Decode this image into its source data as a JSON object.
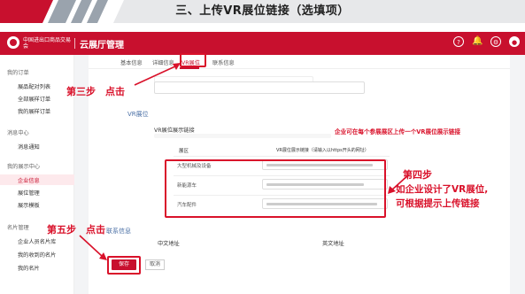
{
  "banner": {
    "title": "三、上传VR展位链接（选填项）"
  },
  "topnav": {
    "org_name": "中国进出口商品交易会",
    "app_title": "云展厅管理",
    "icons": [
      "help-icon",
      "bell-icon",
      "settings-icon",
      "user-icon"
    ]
  },
  "sidebar": {
    "groups": [
      {
        "label": "我的订单",
        "items": [
          "展品配对列表",
          "全部展样订单",
          "我的展样订单"
        ]
      },
      {
        "label": "消息中心",
        "items": [
          "消息通知"
        ]
      },
      {
        "label": "我的展示中心",
        "items": [
          "企业信息",
          "展位管理",
          "展示模板"
        ]
      },
      {
        "label": "名片管理",
        "items": [
          "企业人员名片库",
          "我的收到的名片",
          "我的名片"
        ]
      }
    ],
    "active_item": "企业信息"
  },
  "tabs": [
    "基本信息",
    "详细信息",
    "VR展位",
    "联系信息"
  ],
  "active_tab": "VR展位",
  "section_vr": "VR展位",
  "vr_label": "VR展位展示链接",
  "table": {
    "col1": "展区",
    "col2": "VR展位展示链接（请输入以https开头的网址）",
    "rows": [
      "大型机械及设备",
      "新能源车",
      "汽车配件"
    ]
  },
  "section_contact": "联系信息",
  "contact_labels": [
    "中文地址",
    "英文地址"
  ],
  "buttons": {
    "save": "保存",
    "cancel": "取消"
  },
  "annotations": {
    "step3": "第三步　点击",
    "step4_title": "第四步",
    "step4_line1": "如企业设计了VR展位,",
    "step4_line2": "可根据提示上传链接",
    "step5": "第五步　点击",
    "info": "企业可在每个参展展区上传一个VR展位展示链接"
  },
  "colors": {
    "brand": "#c8102e",
    "annotation": "#d9112a",
    "link": "#4a6fa5"
  }
}
